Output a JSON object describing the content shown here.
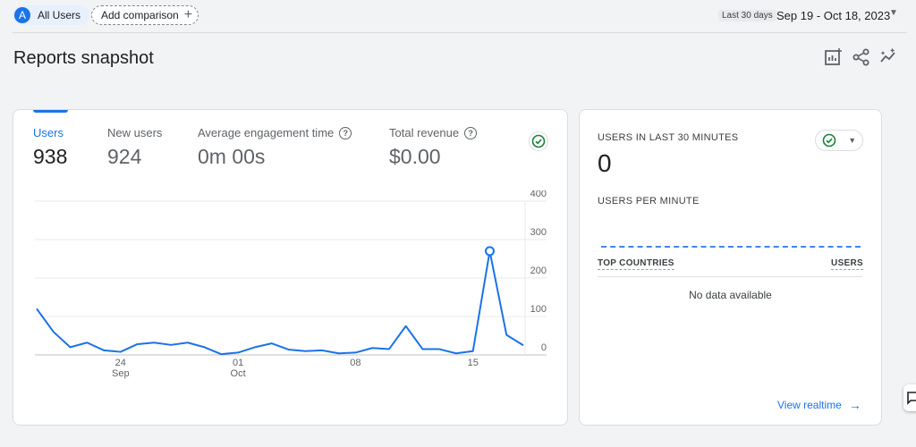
{
  "segment": {
    "avatar_letter": "A",
    "label": "All Users"
  },
  "comparison": {
    "label": "Add comparison"
  },
  "date_range": {
    "badge": "Last 30 days",
    "text": "Sep 19 - Oct 18, 2023"
  },
  "page": {
    "title": "Reports snapshot"
  },
  "header_icons": [
    "customize-report-icon",
    "share-icon",
    "insights-icon"
  ],
  "metrics": [
    {
      "label": "Users",
      "value": "938",
      "active": true
    },
    {
      "label": "New users",
      "value": "924"
    },
    {
      "label": "Average engagement time",
      "value": "0m 00s",
      "help": true
    },
    {
      "label": "Total revenue",
      "value": "$0.00",
      "help": true
    }
  ],
  "chart_data": {
    "type": "line",
    "x": [
      "Sep 19",
      "Sep 20",
      "Sep 21",
      "Sep 22",
      "Sep 23",
      "Sep 24",
      "Sep 25",
      "Sep 26",
      "Sep 27",
      "Sep 28",
      "Sep 29",
      "Sep 30",
      "Oct 01",
      "Oct 02",
      "Oct 03",
      "Oct 04",
      "Oct 05",
      "Oct 06",
      "Oct 07",
      "Oct 08",
      "Oct 09",
      "Oct 10",
      "Oct 11",
      "Oct 12",
      "Oct 13",
      "Oct 14",
      "Oct 15",
      "Oct 16",
      "Oct 17",
      "Oct 18"
    ],
    "series": [
      {
        "values": [
          120,
          60,
          20,
          32,
          12,
          8,
          28,
          32,
          26,
          32,
          20,
          2,
          6,
          20,
          30,
          14,
          10,
          12,
          4,
          6,
          18,
          15,
          75,
          15,
          15,
          4,
          10,
          270,
          52,
          25
        ]
      }
    ],
    "x_tick_labels": [
      {
        "index": 5,
        "day": "24",
        "month": "Sep"
      },
      {
        "index": 12,
        "day": "01",
        "month": "Oct"
      },
      {
        "index": 19,
        "day": "08",
        "month": ""
      },
      {
        "index": 26,
        "day": "15",
        "month": ""
      }
    ],
    "y_ticks": [
      0,
      100,
      200,
      300,
      400
    ],
    "ylim": [
      0,
      400
    ],
    "highlight_index": 27,
    "line_color": "#1a73e8",
    "grid": true
  },
  "realtime": {
    "title": "USERS IN LAST 30 MINUTES",
    "value": "0",
    "per_minute_label": "USERS PER MINUTE",
    "col_countries": "TOP COUNTRIES",
    "col_users": "USERS",
    "empty": "No data available",
    "link": "View realtime"
  }
}
